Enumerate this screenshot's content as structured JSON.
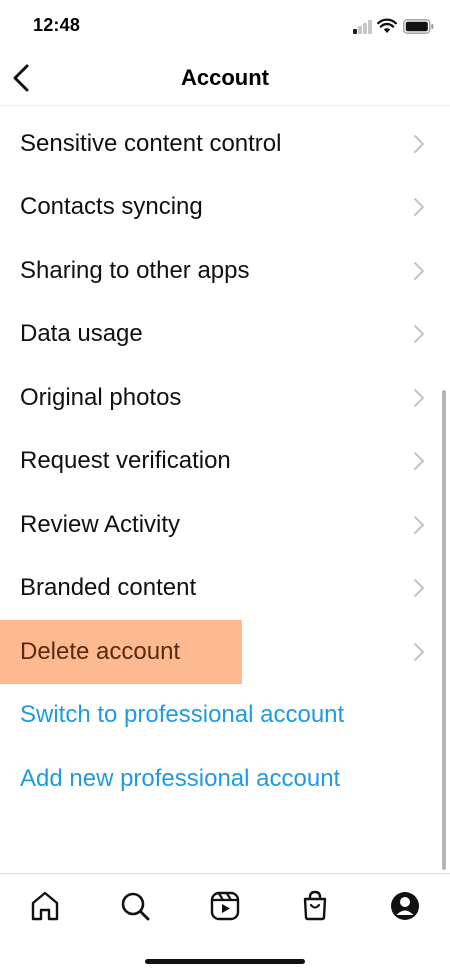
{
  "status_bar": {
    "time": "12:48"
  },
  "header": {
    "title": "Account"
  },
  "list": {
    "items": [
      {
        "label": "Sensitive content control"
      },
      {
        "label": "Contacts syncing"
      },
      {
        "label": "Sharing to other apps"
      },
      {
        "label": "Data usage"
      },
      {
        "label": "Original photos"
      },
      {
        "label": "Request verification"
      },
      {
        "label": "Review Activity"
      },
      {
        "label": "Branded content"
      },
      {
        "label": "Delete account",
        "highlighted": true
      }
    ],
    "links": [
      {
        "label": "Switch to professional account"
      },
      {
        "label": "Add new professional account"
      }
    ]
  },
  "tab_bar": {
    "tabs": [
      "home-icon",
      "search-icon",
      "reels-icon",
      "shop-icon",
      "profile-icon"
    ]
  },
  "colors": {
    "link": "#1f9bde",
    "highlight": "#fdb98f",
    "chevron": "#c4c4c4"
  }
}
